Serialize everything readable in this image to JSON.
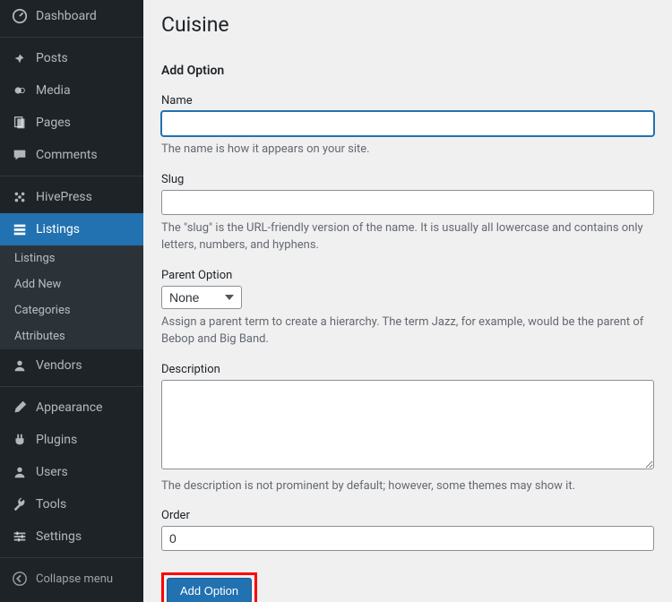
{
  "sidebar": {
    "items": [
      {
        "label": "Dashboard",
        "icon": "dashboard"
      },
      {
        "label": "Posts",
        "icon": "pin"
      },
      {
        "label": "Media",
        "icon": "media"
      },
      {
        "label": "Pages",
        "icon": "pages"
      },
      {
        "label": "Comments",
        "icon": "comment"
      },
      {
        "label": "HivePress",
        "icon": "hive"
      },
      {
        "label": "Listings",
        "icon": "listings",
        "current": true
      },
      {
        "label": "Vendors",
        "icon": "vendor"
      },
      {
        "label": "Appearance",
        "icon": "brush"
      },
      {
        "label": "Plugins",
        "icon": "plug"
      },
      {
        "label": "Users",
        "icon": "user"
      },
      {
        "label": "Tools",
        "icon": "wrench"
      },
      {
        "label": "Settings",
        "icon": "settings"
      }
    ],
    "submenu": [
      "Listings",
      "Add New",
      "Categories",
      "Attributes"
    ],
    "collapse_label": "Collapse menu"
  },
  "page": {
    "title": "Cuisine",
    "section_heading": "Add Option",
    "fields": {
      "name": {
        "label": "Name",
        "value": "",
        "help": "The name is how it appears on your site."
      },
      "slug": {
        "label": "Slug",
        "value": "",
        "help": "The \"slug\" is the URL-friendly version of the name. It is usually all lowercase and contains only letters, numbers, and hyphens."
      },
      "parent": {
        "label": "Parent Option",
        "value": "None",
        "help": "Assign a parent term to create a hierarchy. The term Jazz, for example, would be the parent of Bebop and Big Band."
      },
      "description": {
        "label": "Description",
        "value": "",
        "help": "The description is not prominent by default; however, some themes may show it."
      },
      "order": {
        "label": "Order",
        "value": "0"
      }
    },
    "submit_label": "Add Option"
  }
}
